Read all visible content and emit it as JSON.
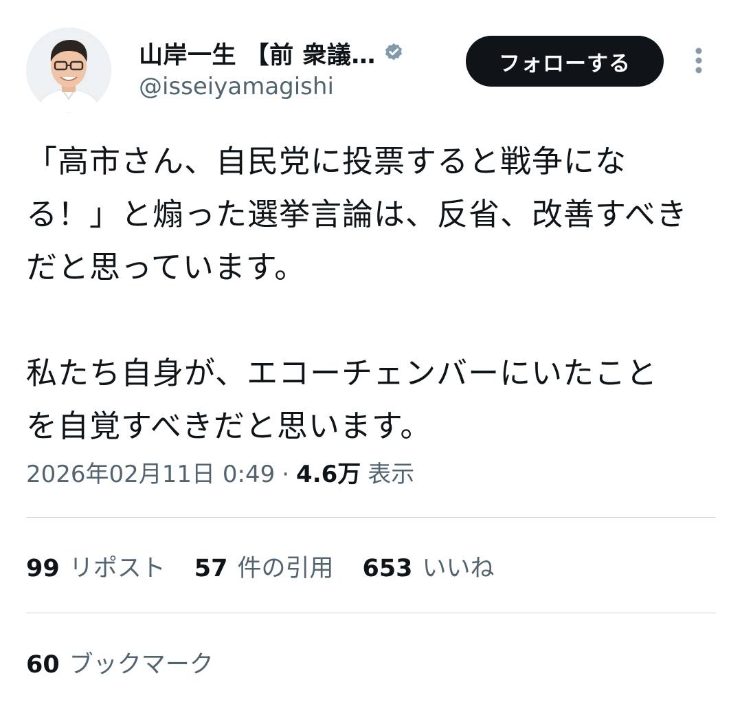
{
  "author": {
    "display_name": "山岸一生 【前 衆議…",
    "handle": "@isseiyamagishi",
    "verified": true,
    "verified_color": "#829aab"
  },
  "actions": {
    "follow_label": "フォローする"
  },
  "tweet": {
    "lines_para1": [
      "「高市さん、自民党に投票すると戦争にな",
      "る！」と煽った選挙言論は、反省、改善すべき",
      "だと思っています。"
    ],
    "lines_para2": [
      "私たち自身が、エコーチェンバーにいたこと",
      "を自覚すべきだと思います。"
    ]
  },
  "meta": {
    "timestamp": "2026年02月11日 0:49",
    "separator": "·",
    "views_count": "4.6万",
    "views_label": "表示"
  },
  "stats": {
    "reposts": {
      "count": "99",
      "label": "リポスト"
    },
    "quotes": {
      "count": "57",
      "label": "件の引用"
    },
    "likes": {
      "count": "653",
      "label": "いいね"
    },
    "bookmarks": {
      "count": "60",
      "label": "ブックマーク"
    }
  },
  "colors": {
    "text_primary": "#0f1419",
    "text_secondary": "#536471",
    "divider": "#cfd9de",
    "follow_button_bg": "#0f1419"
  }
}
